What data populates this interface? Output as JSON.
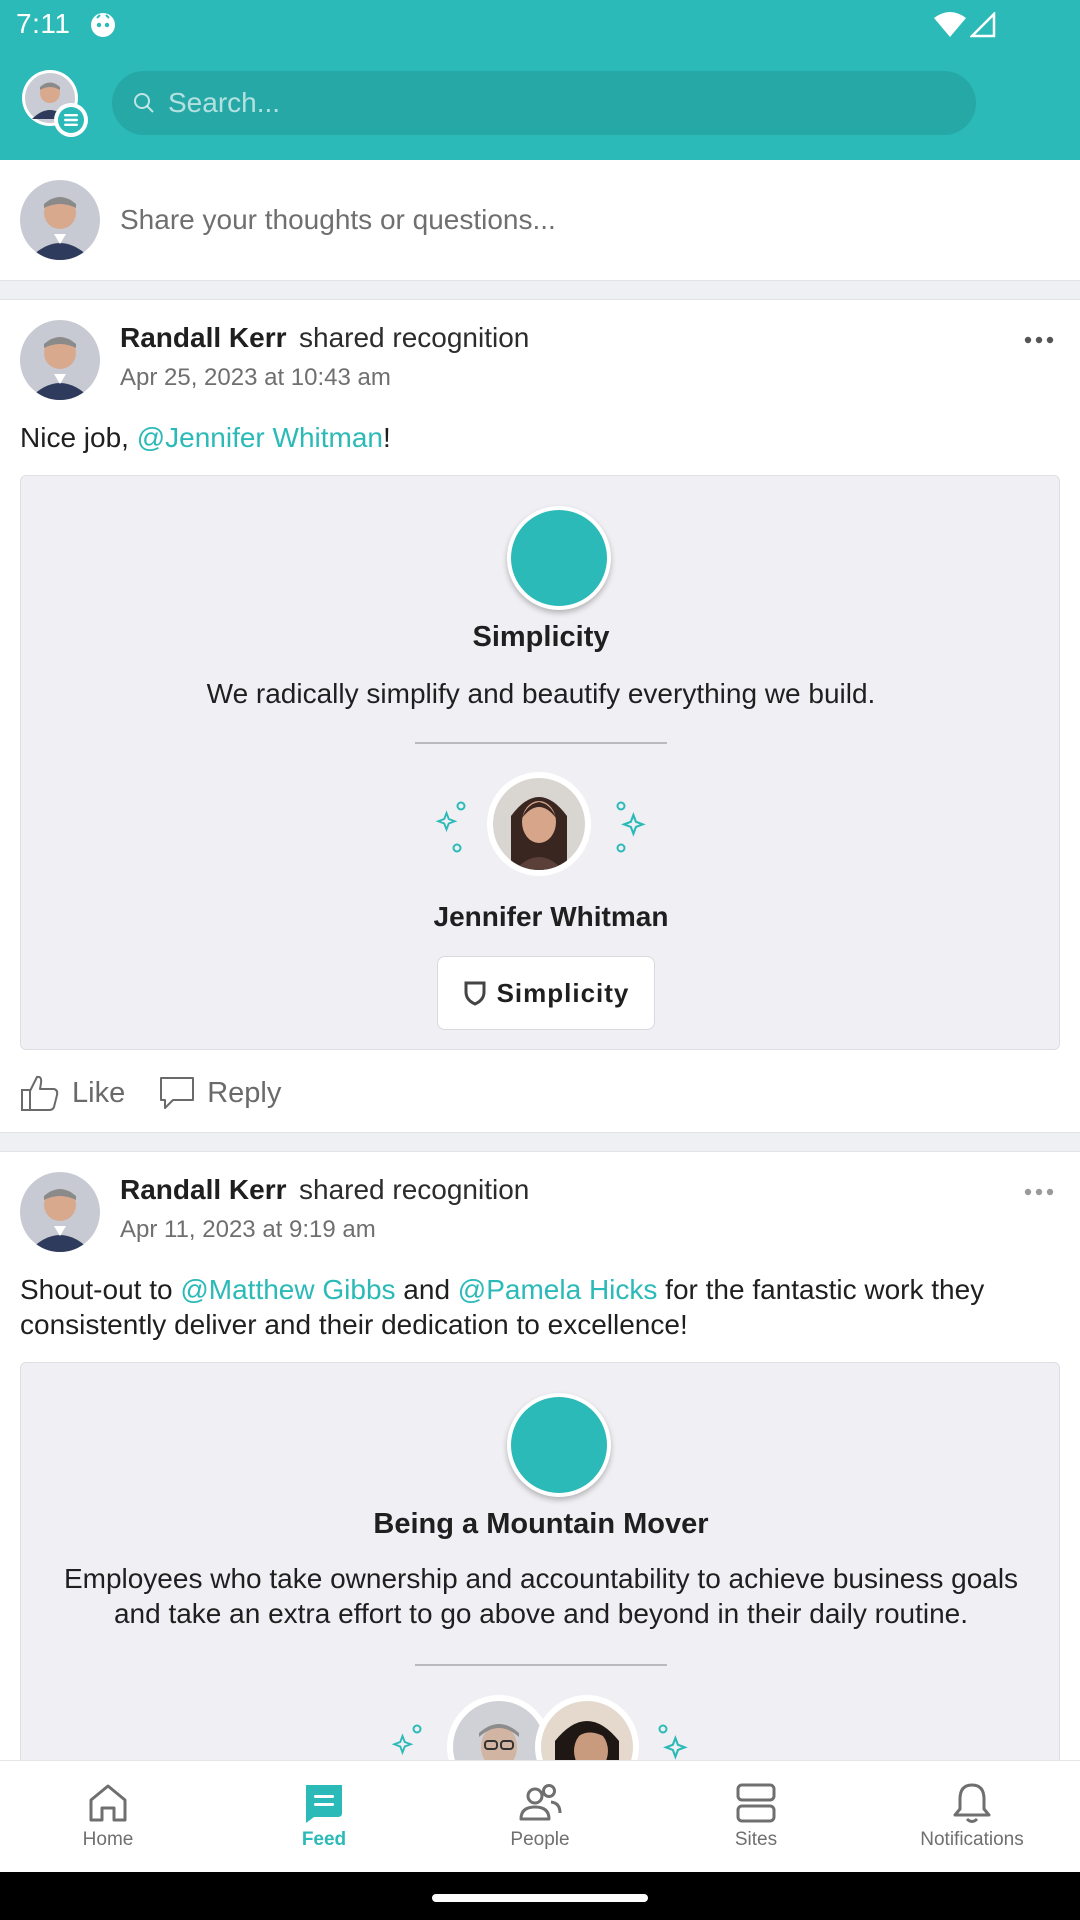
{
  "status_bar": {
    "time": "7:11"
  },
  "header": {
    "search": {
      "placeholder": "Search..."
    }
  },
  "composer": {
    "placeholder": "Share your thoughts or questions..."
  },
  "posts": [
    {
      "author": "Randall Kerr",
      "action": "shared recognition",
      "date": "Apr 25, 2023 at 10:43 am",
      "body": {
        "prefix": "Nice job, ",
        "mention1": "@Jennifer Whitman",
        "suffix": "!"
      },
      "recognition": {
        "value_title": "Simplicity",
        "value_description": "We radically simplify and beautify everything we build.",
        "recipient_name": "Jennifer Whitman",
        "tag_label": "Simplicity"
      },
      "actions": {
        "like": "Like",
        "reply": "Reply"
      }
    },
    {
      "author": "Randall Kerr",
      "action": "shared recognition",
      "date": "Apr 11, 2023 at 9:19 am",
      "body": {
        "prefix": "Shout-out to ",
        "mention1": "@Matthew Gibbs",
        "middle": " and ",
        "mention2": "@Pamela Hicks",
        "suffix": " for the fantastic work they consistently deliver and their dedication to excellence!"
      },
      "recognition": {
        "value_title": "Being a Mountain Mover",
        "value_description": "Employees who take ownership and accountability to achieve business goals and take an extra effort to go above and beyond in their daily routine."
      }
    }
  ],
  "bottom_nav": {
    "items": [
      {
        "label": "Home",
        "icon": "home-icon"
      },
      {
        "label": "Feed",
        "icon": "feed-icon",
        "active": true
      },
      {
        "label": "People",
        "icon": "people-icon"
      },
      {
        "label": "Sites",
        "icon": "sites-icon"
      },
      {
        "label": "Notifications",
        "icon": "bell-icon"
      }
    ]
  },
  "colors": {
    "accent": "#2bbab8",
    "card_bg": "#f0f0f4",
    "text": "#1f1f1f",
    "muted": "#6f6f6f"
  }
}
